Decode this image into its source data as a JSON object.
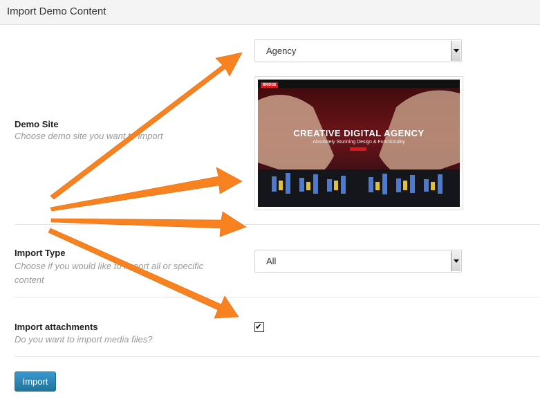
{
  "header": {
    "title": "Import Demo Content"
  },
  "demo_site": {
    "label": "Demo Site",
    "description": "Choose demo site you want to import",
    "selected": "Agency",
    "preview": {
      "logo": "BRIDGE",
      "headline": "CREATIVE DIGITAL AGENCY",
      "subline": "Absolutely Stunning Design & Functionality"
    }
  },
  "import_type": {
    "label": "Import Type",
    "description": "Choose if you would like to import all or specific content",
    "selected": "All"
  },
  "import_attachments": {
    "label": "Import attachments",
    "description": "Do you want to import media files?",
    "checked": true,
    "check_glyph": "✔"
  },
  "import_button": {
    "label": "Import"
  },
  "colors": {
    "accent_button": "#2a7fb0",
    "annotation_arrow": "#f7821f"
  }
}
